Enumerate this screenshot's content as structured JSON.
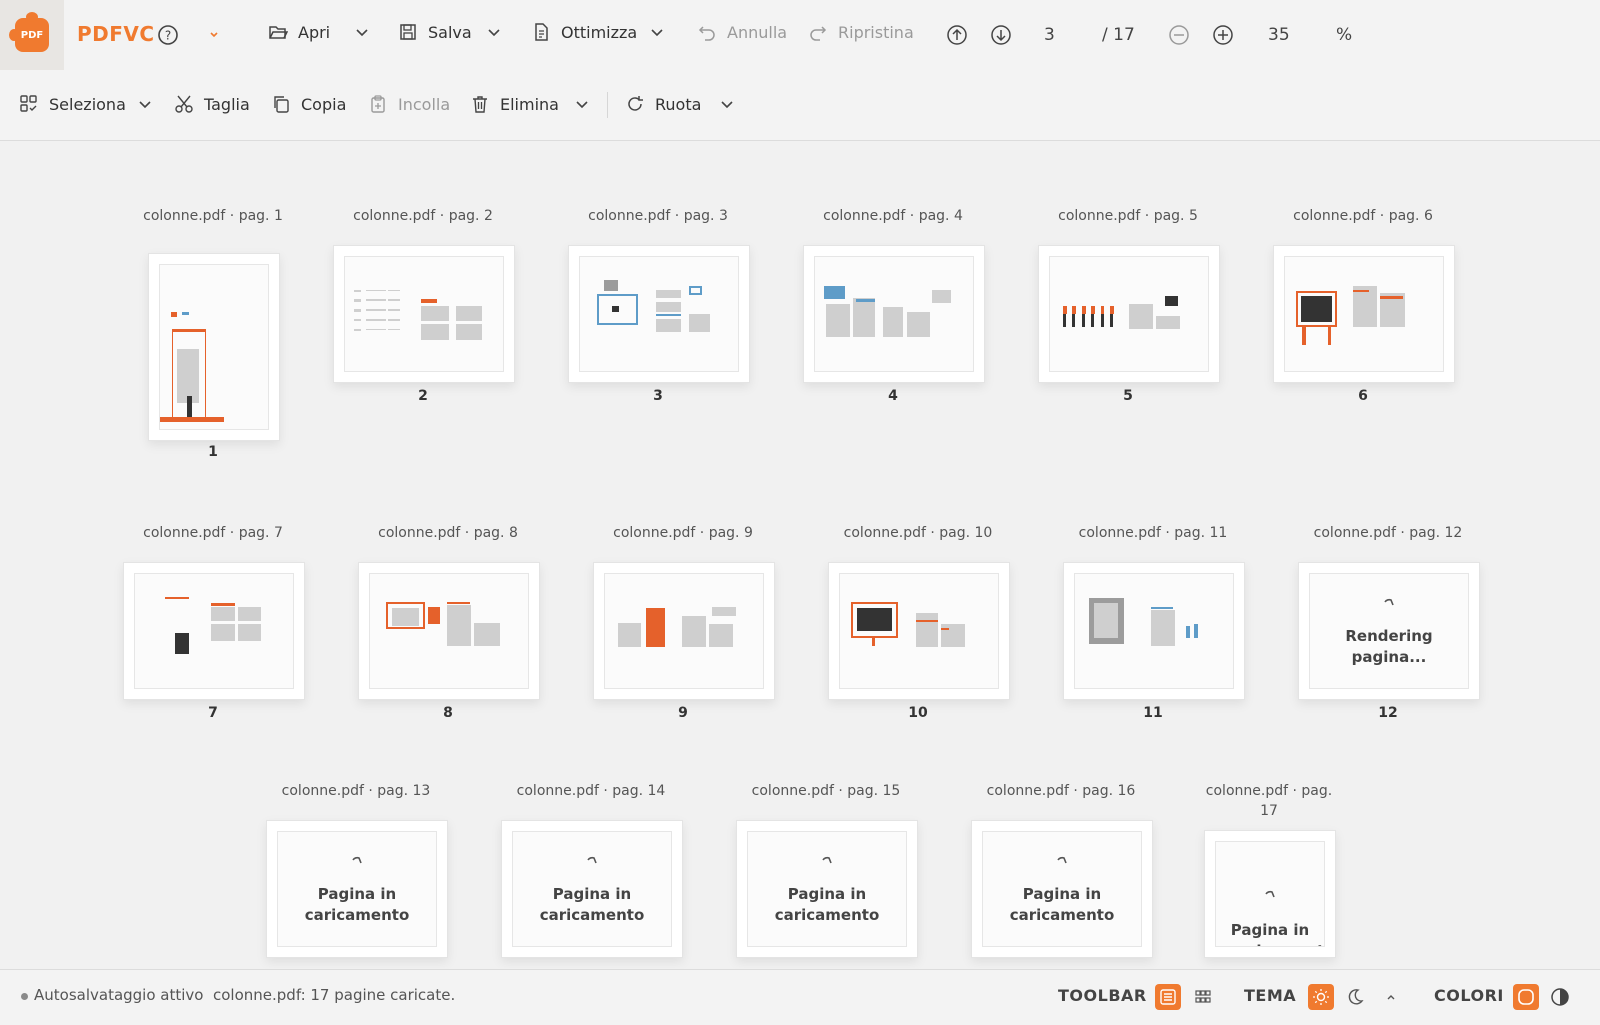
{
  "app": {
    "name": "PDFVC",
    "logo_text": "PDF"
  },
  "toolbar": {
    "open_label": "Apri",
    "save_label": "Salva",
    "optimize_label": "Ottimizza",
    "undo_label": "Annulla",
    "redo_label": "Ripristina",
    "current_page": "3",
    "total_pages": "/ 17",
    "zoom_value": "35",
    "zoom_unit": "%"
  },
  "toolbar2": {
    "select_label": "Seleziona",
    "cut_label": "Taglia",
    "copy_label": "Copia",
    "paste_label": "Incolla",
    "delete_label": "Elimina",
    "rotate_label": "Ruota"
  },
  "pages": [
    {
      "label": "colonne.pdf · pag. 1",
      "num": "1",
      "state": "rendered",
      "selected": false
    },
    {
      "label": "colonne.pdf · pag. 2",
      "num": "2",
      "state": "rendered",
      "selected": true
    },
    {
      "label": "colonne.pdf · pag. 3",
      "num": "3",
      "state": "rendered",
      "selected": true
    },
    {
      "label": "colonne.pdf · pag. 4",
      "num": "4",
      "state": "rendered",
      "selected": false
    },
    {
      "label": "colonne.pdf · pag. 5",
      "num": "5",
      "state": "rendered",
      "selected": false
    },
    {
      "label": "colonne.pdf · pag. 6",
      "num": "6",
      "state": "rendered",
      "selected": false
    },
    {
      "label": "colonne.pdf · pag. 7",
      "num": "7",
      "state": "rendered",
      "selected": false
    },
    {
      "label": "colonne.pdf · pag. 8",
      "num": "8",
      "state": "rendered",
      "selected": false
    },
    {
      "label": "colonne.pdf · pag. 9",
      "num": "9",
      "state": "rendered",
      "selected": false
    },
    {
      "label": "colonne.pdf · pag. 10",
      "num": "10",
      "state": "rendered",
      "selected": false
    },
    {
      "label": "colonne.pdf · pag. 11",
      "num": "11",
      "state": "rendered",
      "selected": false
    },
    {
      "label": "colonne.pdf · pag. 12",
      "num": "12",
      "state": "rendering",
      "selected": false,
      "message": "Rendering pagina..."
    },
    {
      "label": "colonne.pdf · pag. 13",
      "num": "13",
      "state": "loading",
      "selected": false,
      "message": "Pagina in caricamento"
    },
    {
      "label": "colonne.pdf · pag. 14",
      "num": "14",
      "state": "loading",
      "selected": false,
      "message": "Pagina in caricamento"
    },
    {
      "label": "colonne.pdf · pag. 15",
      "num": "15",
      "state": "loading",
      "selected": false,
      "message": "Pagina in caricamento"
    },
    {
      "label": "colonne.pdf · pag. 16",
      "num": "16",
      "state": "loading",
      "selected": false,
      "message": "Pagina in caricamento"
    },
    {
      "label": "colonne.pdf · pag. 17",
      "num": "17",
      "state": "loading",
      "selected": false,
      "message": "Pagina in caricamento"
    }
  ],
  "status": {
    "autosave": "Autosalvataggio attivo",
    "message": "colonne.pdf: 17 pagine caricate.",
    "toolbar_label": "TOOLBAR",
    "theme_label": "TEMA",
    "colors_label": "COLORI"
  },
  "colors": {
    "accent": "#f07a2f"
  }
}
